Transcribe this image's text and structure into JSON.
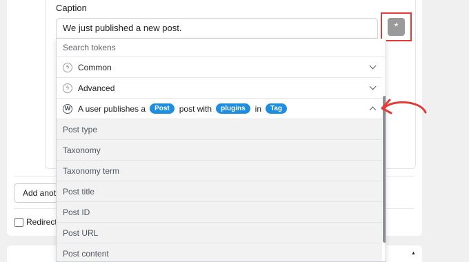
{
  "caption": {
    "label": "Caption",
    "value": "We just published a new post."
  },
  "token_button": {
    "symbol": "*"
  },
  "dropdown": {
    "search_placeholder": "Search tokens",
    "groups": [
      {
        "label": "Common",
        "icon": "plug-icon",
        "expanded": false
      },
      {
        "label": "Advanced",
        "icon": "plug-icon",
        "expanded": false
      }
    ],
    "trigger_group": {
      "icon": "wordpress-icon",
      "text_1": "A user publishes a",
      "tag_1": "Post",
      "text_2": "post with",
      "tag_2": "plugins",
      "text_3": "in",
      "tag_3": "Tag",
      "expanded": true
    },
    "tokens": [
      "Post type",
      "Taxonomy",
      "Taxonomy term",
      "Post title",
      "Post ID",
      "Post URL",
      "Post content"
    ]
  },
  "actions": {
    "add_another": "Add anoth"
  },
  "redirect": {
    "label": "Redirect"
  },
  "colors": {
    "tag_blue": "#1e8fe0",
    "highlight_red": "#e53935"
  }
}
